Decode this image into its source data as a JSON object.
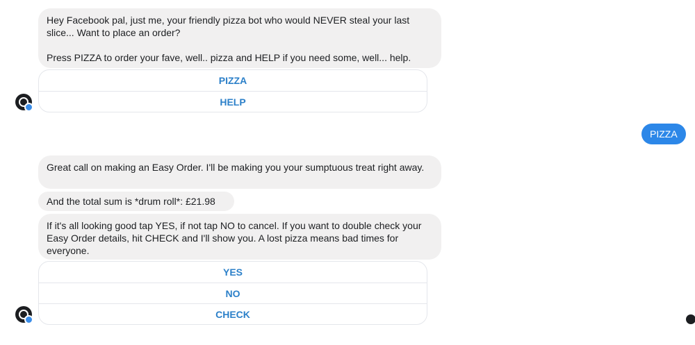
{
  "conversation": {
    "bot_messages_1": {
      "greeting": "Hey Facebook pal, just me, your friendly pizza bot who would NEVER steal your last slice... Want to place an order?\n\nPress PIZZA to order your fave, well.. pizza and HELP if you need some, well... help.",
      "quick_replies": [
        "PIZZA",
        "HELP"
      ]
    },
    "user_reply": "PIZZA",
    "bot_messages_2": {
      "confirmation": "Great call on making an Easy Order. I'll be making you your sumptuous treat right away.",
      "total": "And the total sum is *drum roll*: £21.98",
      "prompt": "If it's all looking good tap YES, if not tap NO to cancel. If you want to double check your Easy Order details, hit CHECK and I'll show you. A lost pizza means bad times for everyone.",
      "quick_replies": [
        "YES",
        "NO",
        "CHECK"
      ]
    }
  },
  "colors": {
    "bot_bubble": "#f1f0f0",
    "user_bubble": "#2c87e8",
    "quick_reply_text": "#2c80c9"
  },
  "icons": {
    "bot_avatar": "bot-avatar-icon",
    "verified_badge": "verified-badge-icon",
    "seen_indicator": "seen-indicator-icon"
  }
}
